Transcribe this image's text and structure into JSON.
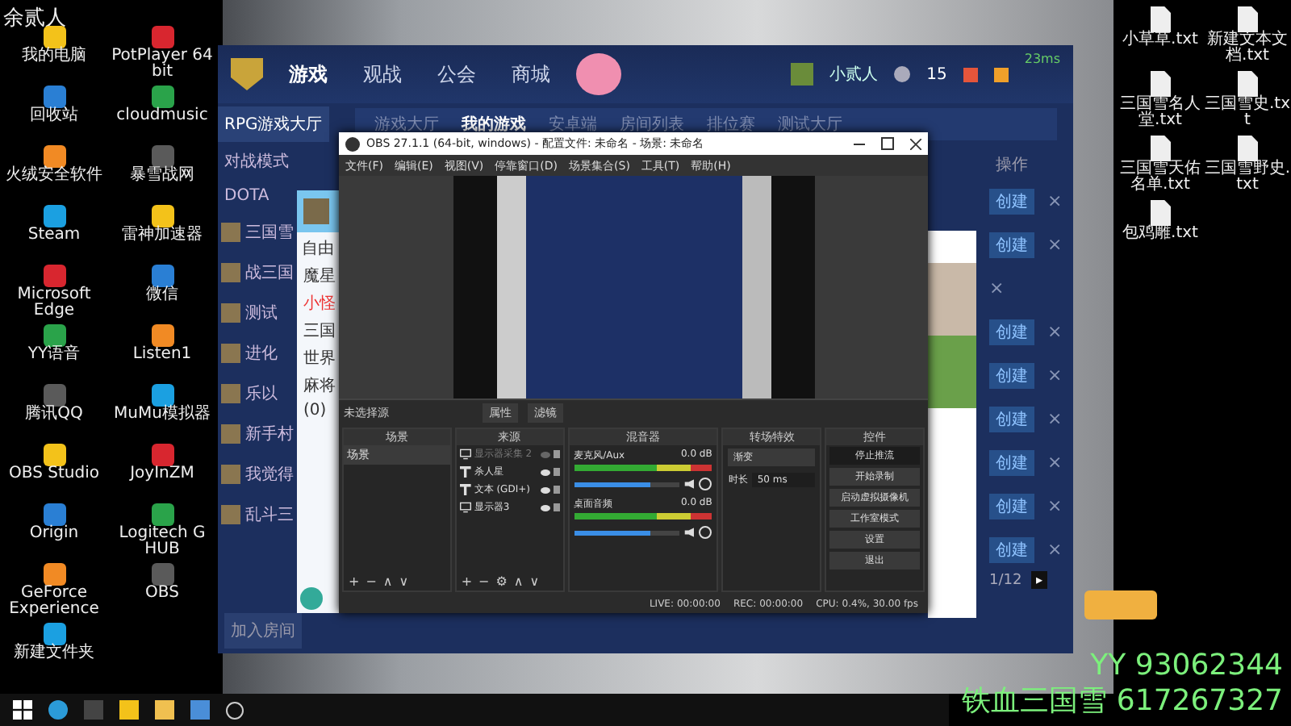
{
  "stream_name": "余贰人",
  "desktop_icons_left": [
    {
      "label": "我的电脑"
    },
    {
      "label": "PotPlayer 64 bit"
    },
    {
      "label": "回收站"
    },
    {
      "label": "cloudmusic"
    },
    {
      "label": "火绒安全软件"
    },
    {
      "label": "暴雪战网"
    },
    {
      "label": "Steam"
    },
    {
      "label": "雷神加速器"
    },
    {
      "label": "Microsoft Edge"
    },
    {
      "label": "微信"
    },
    {
      "label": "YY语音"
    },
    {
      "label": "Listen1"
    },
    {
      "label": "腾讯QQ"
    },
    {
      "label": "MuMu模拟器"
    },
    {
      "label": "OBS Studio"
    },
    {
      "label": "JoyInZM"
    },
    {
      "label": "Origin"
    },
    {
      "label": "Logitech G HUB"
    },
    {
      "label": "GeForce Experience"
    },
    {
      "label": "OBS"
    },
    {
      "label": "新建文件夹"
    }
  ],
  "desktop_icons_right": [
    {
      "label": "小草草.txt"
    },
    {
      "label": "新建文本文档.txt"
    },
    {
      "label": "三国雪名人堂.txt"
    },
    {
      "label": "三国雪史.txt"
    },
    {
      "label": "三国雪天佑名单.txt"
    },
    {
      "label": "三国雪野史.txt"
    },
    {
      "label": "包鸡雕.txt"
    }
  ],
  "launcher": {
    "ping": "23ms",
    "nav": [
      {
        "label": "游戏",
        "selected": true
      },
      {
        "label": "观战",
        "selected": false
      },
      {
        "label": "公会",
        "selected": false
      },
      {
        "label": "商城",
        "selected": false
      }
    ],
    "user": "小贰人",
    "friend_count": "15",
    "subtabs": [
      {
        "label": "游戏大厅",
        "selected": false
      },
      {
        "label": "我的游戏",
        "selected": true
      },
      {
        "label": "安卓端",
        "selected": false
      },
      {
        "label": "房间列表",
        "selected": false
      },
      {
        "label": "排位赛",
        "selected": false
      },
      {
        "label": "测试大厅",
        "selected": false
      }
    ],
    "sidebar": [
      {
        "label": "RPG游戏大厅",
        "selected": true
      },
      {
        "label": "对战模式",
        "selected": false
      },
      {
        "label": "DOTA",
        "selected": false
      }
    ],
    "games": [
      {
        "label": "三国雪"
      },
      {
        "label": "战三国"
      },
      {
        "label": "测试"
      },
      {
        "label": "进化"
      },
      {
        "label": "乐以"
      },
      {
        "label": "新手村"
      },
      {
        "label": "我觉得"
      },
      {
        "label": "乱斗三"
      }
    ],
    "join_button": "加入房间",
    "actions_header": "操作",
    "rows": [
      {
        "create": "创建"
      },
      {
        "create": "创建"
      },
      {
        "create": ""
      },
      {
        "create": "创建"
      },
      {
        "create": "创建"
      },
      {
        "create": "创建"
      },
      {
        "create": "创建"
      },
      {
        "create": "创建"
      },
      {
        "create": "创建"
      }
    ],
    "close_glyph": "×",
    "page": "1/12",
    "next_glyph": "▸"
  },
  "chat": {
    "mode": "自由",
    "groups": [
      {
        "label": "魔星",
        "highlight": false
      },
      {
        "label": "小怪",
        "highlight": true
      },
      {
        "label": "三国",
        "highlight": false
      },
      {
        "label": "世界",
        "highlight": false
      },
      {
        "label": "麻将",
        "highlight": false
      },
      {
        "label": "(0)",
        "highlight": false
      }
    ]
  },
  "obs": {
    "title": "OBS 27.1.1 (64-bit, windows) - 配置文件: 未命名 - 场景: 未命名",
    "menu": [
      "文件(F)",
      "编辑(E)",
      "视图(V)",
      "停靠窗口(D)",
      "场景集合(S)",
      "工具(T)",
      "帮助(H)"
    ],
    "no_source": "未选择源",
    "properties": "属性",
    "filters": "滤镜",
    "scenes": {
      "title": "场景",
      "items": [
        {
          "label": "场景",
          "selected": true
        }
      ],
      "toolbar": [
        "+",
        "−",
        "∧",
        "∨"
      ]
    },
    "sources": {
      "title": "来源",
      "items": [
        {
          "label": "显示器采集 2",
          "kind": "display",
          "visible": false
        },
        {
          "label": "杀人星",
          "kind": "text",
          "visible": true
        },
        {
          "label": "文本 (GDI+)",
          "kind": "text",
          "visible": true
        },
        {
          "label": "显示器3",
          "kind": "display",
          "visible": true
        }
      ],
      "toolbar": [
        "+",
        "−",
        "⚙",
        "∧",
        "∨"
      ]
    },
    "mixer": {
      "title": "混音器",
      "channels": [
        {
          "name": "麦克风/Aux",
          "reading": "0.0 dB",
          "level": 0.72
        },
        {
          "name": "桌面音频",
          "reading": "0.0 dB",
          "level": 0.72
        }
      ]
    },
    "transitions": {
      "title": "转场特效",
      "type": "渐变",
      "duration_label": "时长",
      "duration": "50 ms"
    },
    "controls": {
      "title": "控件",
      "buttons": [
        {
          "label": "停止推流",
          "active": true
        },
        {
          "label": "开始录制",
          "active": false
        },
        {
          "label": "启动虚拟摄像机",
          "active": false
        },
        {
          "label": "工作室模式",
          "active": false
        },
        {
          "label": "设置",
          "active": false
        },
        {
          "label": "退出",
          "active": false
        }
      ]
    },
    "status": [
      {
        "label": "LIVE:",
        "value": "00:00:00"
      },
      {
        "label": "REC:",
        "value": "00:00:00"
      },
      {
        "label": "CPU:",
        "value": "0.4%, 30.00 fps"
      }
    ]
  },
  "overlay": [
    "YY 93062344",
    "铁血三国雪 617267327"
  ]
}
